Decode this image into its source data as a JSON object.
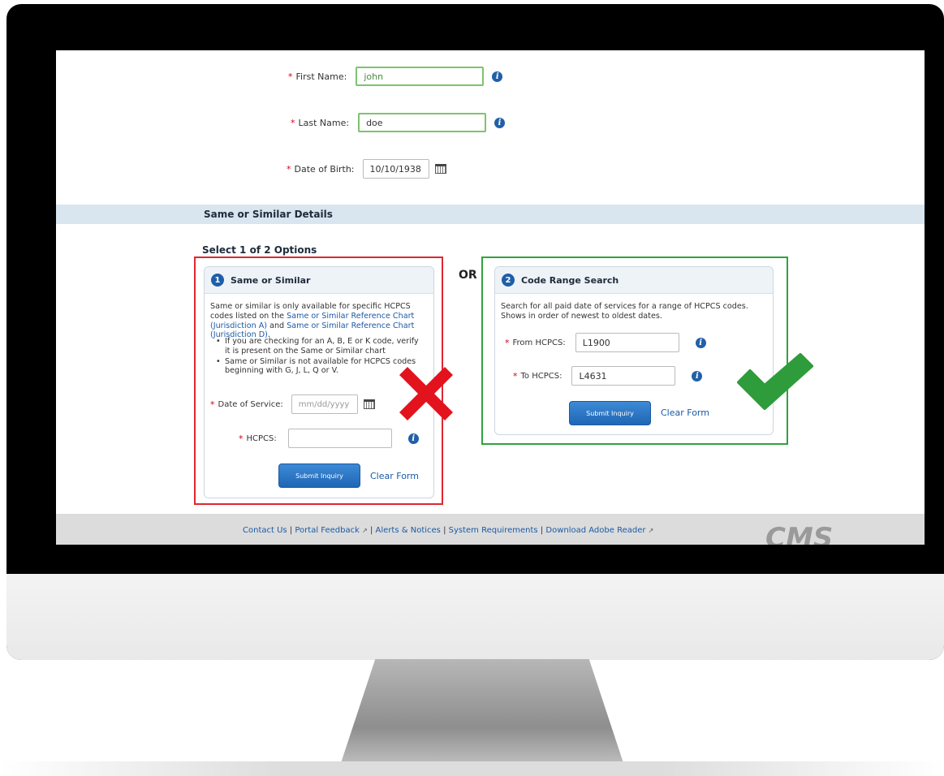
{
  "form": {
    "first_name": {
      "required": "*",
      "label": "First Name:",
      "value": "john"
    },
    "last_name": {
      "required": "*",
      "label": "Last Name:",
      "value": "doe"
    },
    "dob": {
      "required": "*",
      "label": "Date of Birth:",
      "value": "10/10/1938"
    }
  },
  "section": {
    "title": "Same or Similar Details",
    "subtitle": "Select 1 of 2 Options",
    "or_label": "OR"
  },
  "option1": {
    "number": "1",
    "title": "Same or Similar",
    "desc_pre": "Same or similar is only available for specific HCPCS codes listed on the ",
    "link_a": "Same or Similar Reference Chart (Jurisdiction A)",
    "desc_and": " and ",
    "link_d": "Same or Similar Reference Chart (Jurisdiction D)",
    "desc_end": ".",
    "bullets": [
      "If you are checking for an A, B, E or K code, verify it is present on the Same or Similar chart",
      "Same or Similar is not available for HCPCS codes beginning with G, J, L, Q or V."
    ],
    "dos_label": "Date of Service:",
    "dos_placeholder": "mm/dd/yyyy",
    "hcpcs_label": "HCPCS:",
    "hcpcs_value": "",
    "submit": "Submit Inquiry",
    "clear": "Clear Form",
    "required": "*"
  },
  "option2": {
    "number": "2",
    "title": "Code Range Search",
    "desc": "Search for all paid date of services for a range of HCPCS codes. Shows in order of newest to oldest dates.",
    "from_label": "From HCPCS:",
    "from_value": "L1900",
    "to_label": "To HCPCS:",
    "to_value": "L4631",
    "submit": "Submit Inquiry",
    "clear": "Clear Form",
    "required": "*"
  },
  "footer": {
    "contact": "Contact Us",
    "feedback": "Portal Feedback",
    "alerts": "Alerts & Notices",
    "system": "System Requirements",
    "adobe": "Download Adobe Reader",
    "sep": "|",
    "logo": "CMS"
  },
  "colors": {
    "red_mark": "#e3131e",
    "green_mark": "#2e9c3a",
    "accent": "#1f5ea8"
  }
}
